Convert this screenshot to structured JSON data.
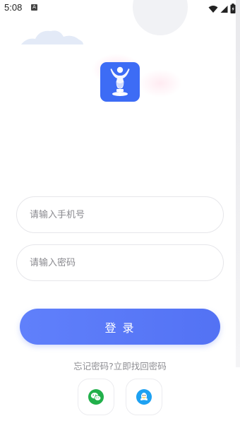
{
  "status_bar": {
    "time": "5:08",
    "notification_letter": "A"
  },
  "login_form": {
    "phone_placeholder": "请输入手机号",
    "password_placeholder": "请输入密码",
    "login_label": "登 录",
    "forgot_text": "忘记密码?立即找回密码"
  },
  "social_login": {
    "items": [
      {
        "icon": "wechat-icon",
        "color": "#22b04b"
      },
      {
        "icon": "qq-icon",
        "color": "#1da1f2"
      }
    ]
  },
  "colors": {
    "accent": "#5a78f8",
    "logo_bg": "#3d6cf5"
  }
}
